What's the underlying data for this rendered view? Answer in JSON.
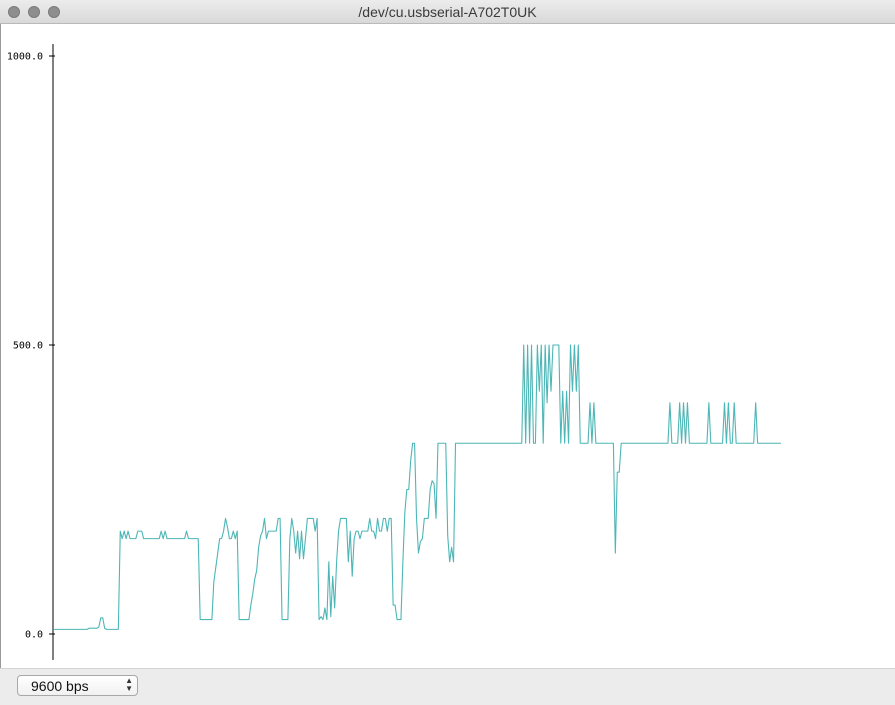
{
  "window": {
    "title": "/dev/cu.usbserial-A702T0UK"
  },
  "footer": {
    "baud_rate": "9600 bps"
  },
  "chart_data": {
    "type": "line",
    "title": "",
    "xlabel": "",
    "ylabel": "",
    "ylim": [
      -5,
      1060
    ],
    "ytick_values": [
      0,
      500,
      1000
    ],
    "ytick_labels": [
      "0.0",
      "500.0",
      "1000.0"
    ],
    "grid": false,
    "series": [
      {
        "color": "#4db6b6",
        "values": [
          8,
          8,
          8,
          8,
          8,
          8,
          8,
          8,
          8,
          8,
          8,
          8,
          8,
          8,
          8,
          8,
          8,
          8,
          10,
          10,
          10,
          10,
          10,
          12,
          28,
          28,
          10,
          8,
          8,
          8,
          8,
          8,
          8,
          8,
          178,
          165,
          178,
          165,
          178,
          165,
          165,
          165,
          165,
          178,
          178,
          178,
          165,
          165,
          165,
          165,
          165,
          165,
          165,
          165,
          165,
          178,
          165,
          178,
          165,
          165,
          165,
          165,
          165,
          165,
          165,
          165,
          165,
          165,
          178,
          165,
          165,
          165,
          165,
          165,
          165,
          25,
          25,
          25,
          25,
          25,
          25,
          25,
          90,
          115,
          140,
          165,
          165,
          178,
          200,
          185,
          165,
          165,
          178,
          165,
          178,
          25,
          25,
          25,
          25,
          25,
          25,
          50,
          70,
          95,
          110,
          150,
          170,
          178,
          200,
          165,
          178,
          178,
          178,
          178,
          178,
          200,
          200,
          25,
          25,
          25,
          25,
          165,
          200,
          178,
          140,
          178,
          130,
          178,
          130,
          165,
          200,
          200,
          200,
          200,
          178,
          200,
          25,
          30,
          25,
          45,
          25,
          125,
          30,
          100,
          45,
          125,
          178,
          200,
          200,
          200,
          200,
          125,
          178,
          100,
          165,
          178,
          178,
          165,
          178,
          178,
          178,
          178,
          200,
          178,
          178,
          165,
          200,
          178,
          178,
          200,
          200,
          178,
          200,
          200,
          50,
          50,
          25,
          25,
          25,
          125,
          210,
          250,
          250,
          300,
          330,
          330,
          200,
          140,
          160,
          165,
          200,
          200,
          200,
          250,
          265,
          260,
          200,
          330,
          330,
          330,
          330,
          330,
          170,
          125,
          150,
          125,
          330,
          330,
          330,
          330,
          330,
          330,
          330,
          330,
          330,
          330,
          330,
          330,
          330,
          330,
          330,
          330,
          330,
          330,
          330,
          330,
          330,
          330,
          330,
          330,
          330,
          330,
          330,
          330,
          330,
          330,
          330,
          330,
          330,
          330,
          330,
          500,
          330,
          500,
          330,
          500,
          330,
          330,
          500,
          420,
          500,
          330,
          500,
          400,
          500,
          420,
          500,
          500,
          500,
          500,
          330,
          420,
          330,
          420,
          330,
          500,
          420,
          500,
          420,
          500,
          330,
          330,
          330,
          330,
          330,
          400,
          330,
          400,
          330,
          330,
          330,
          330,
          330,
          330,
          330,
          330,
          330,
          330,
          140,
          280,
          280,
          330,
          330,
          330,
          330,
          330,
          330,
          330,
          330,
          330,
          330,
          330,
          330,
          330,
          330,
          330,
          330,
          330,
          330,
          330,
          330,
          330,
          330,
          330,
          330,
          330,
          400,
          330,
          330,
          330,
          330,
          400,
          330,
          400,
          330,
          400,
          330,
          330,
          330,
          330,
          330,
          330,
          330,
          330,
          330,
          330,
          400,
          330,
          330,
          330,
          330,
          330,
          330,
          330,
          400,
          330,
          400,
          330,
          330,
          400,
          330,
          330,
          330,
          330,
          330,
          330,
          330,
          330,
          330,
          330,
          400,
          330,
          330,
          330,
          330,
          330,
          330,
          330,
          330,
          330,
          330,
          330,
          330,
          330
        ]
      }
    ]
  }
}
